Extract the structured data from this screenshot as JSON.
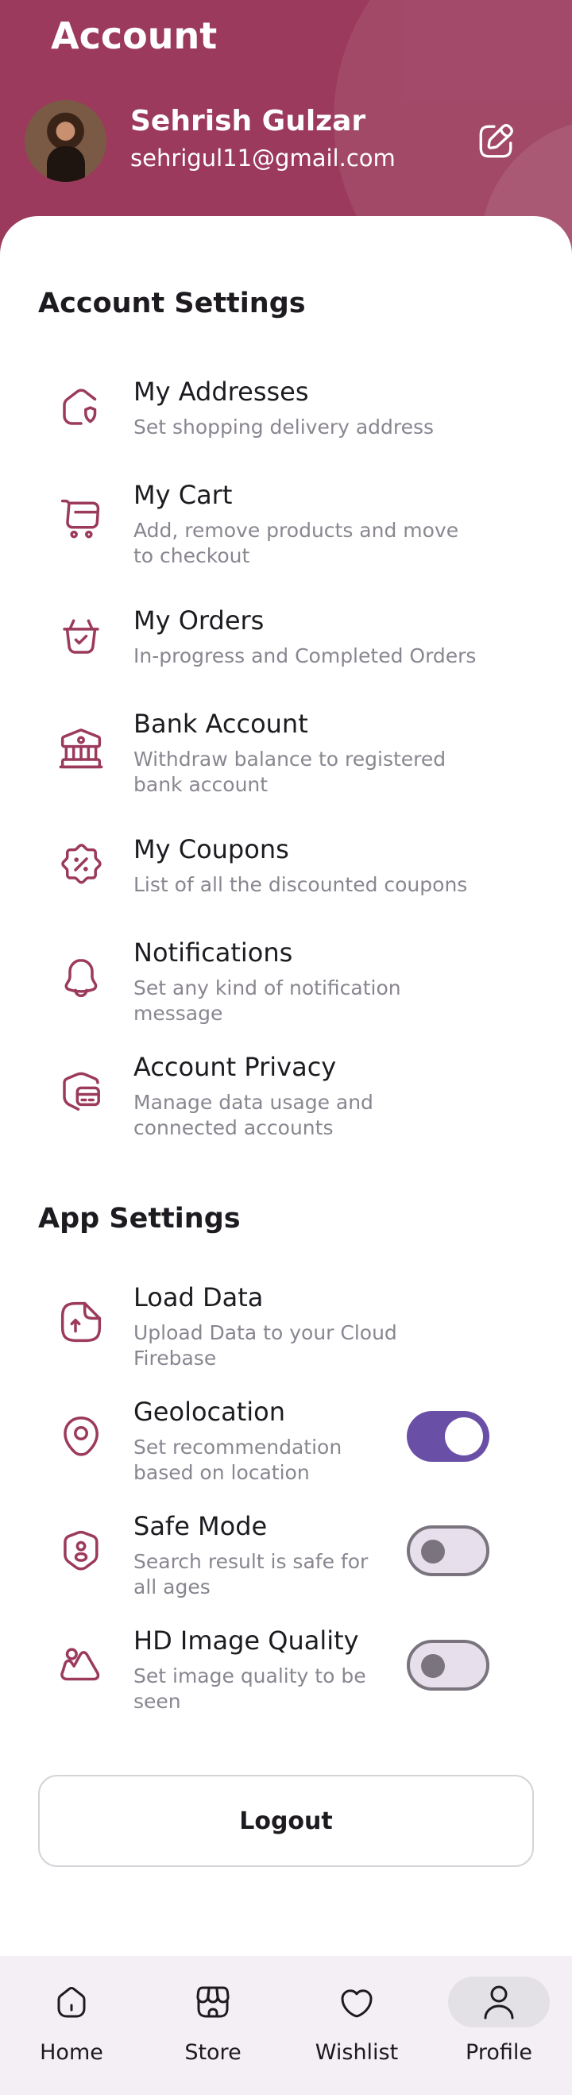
{
  "header": {
    "title": "Account",
    "user_name": "Sehrish Gulzar",
    "user_email": "sehrigul11@gmail.com",
    "edit_icon": "edit-icon"
  },
  "account_settings": {
    "title": "Account Settings",
    "items": [
      {
        "icon": "home-shield-icon",
        "label": "My Addresses",
        "description": "Set shopping delivery address"
      },
      {
        "icon": "cart-icon",
        "label": "My Cart",
        "description": "Add, remove products and move to checkout"
      },
      {
        "icon": "basket-check-icon",
        "label": "My Orders",
        "description": "In-progress and Completed Orders"
      },
      {
        "icon": "bank-icon",
        "label": "Bank Account",
        "description": "Withdraw balance to registered bank account"
      },
      {
        "icon": "discount-icon",
        "label": "My Coupons",
        "description": "List of all the discounted coupons"
      },
      {
        "icon": "bell-icon",
        "label": "Notifications",
        "description": "Set any kind of notification message"
      },
      {
        "icon": "security-card-icon",
        "label": "Account Privacy",
        "description": "Manage data usage and connected accounts"
      }
    ]
  },
  "app_settings": {
    "title": "App Settings",
    "items": [
      {
        "icon": "document-upload-icon",
        "label": "Load Data",
        "description": "Upload Data to your Cloud Firebase"
      },
      {
        "icon": "location-icon",
        "label": "Geolocation",
        "description": "Set recommendation based on location",
        "toggle": true
      },
      {
        "icon": "security-user-icon",
        "label": "Safe Mode",
        "description": "Search result is safe for all ages",
        "toggle": false
      },
      {
        "icon": "image-icon",
        "label": "HD Image Quality",
        "description": "Set image quality to be seen",
        "toggle": false
      }
    ]
  },
  "logout_label": "Logout",
  "bottom_nav": [
    {
      "icon": "home-icon",
      "label": "Home",
      "active": false
    },
    {
      "icon": "store-icon",
      "label": "Store",
      "active": false
    },
    {
      "icon": "heart-icon",
      "label": "Wishlist",
      "active": false
    },
    {
      "icon": "user-icon",
      "label": "Profile",
      "active": true
    }
  ],
  "colors": {
    "primary": "#9b3a5c",
    "toggle_on": "#6a4fa7",
    "text_secondary": "#8a8690",
    "nav_background": "#f3eff4"
  }
}
